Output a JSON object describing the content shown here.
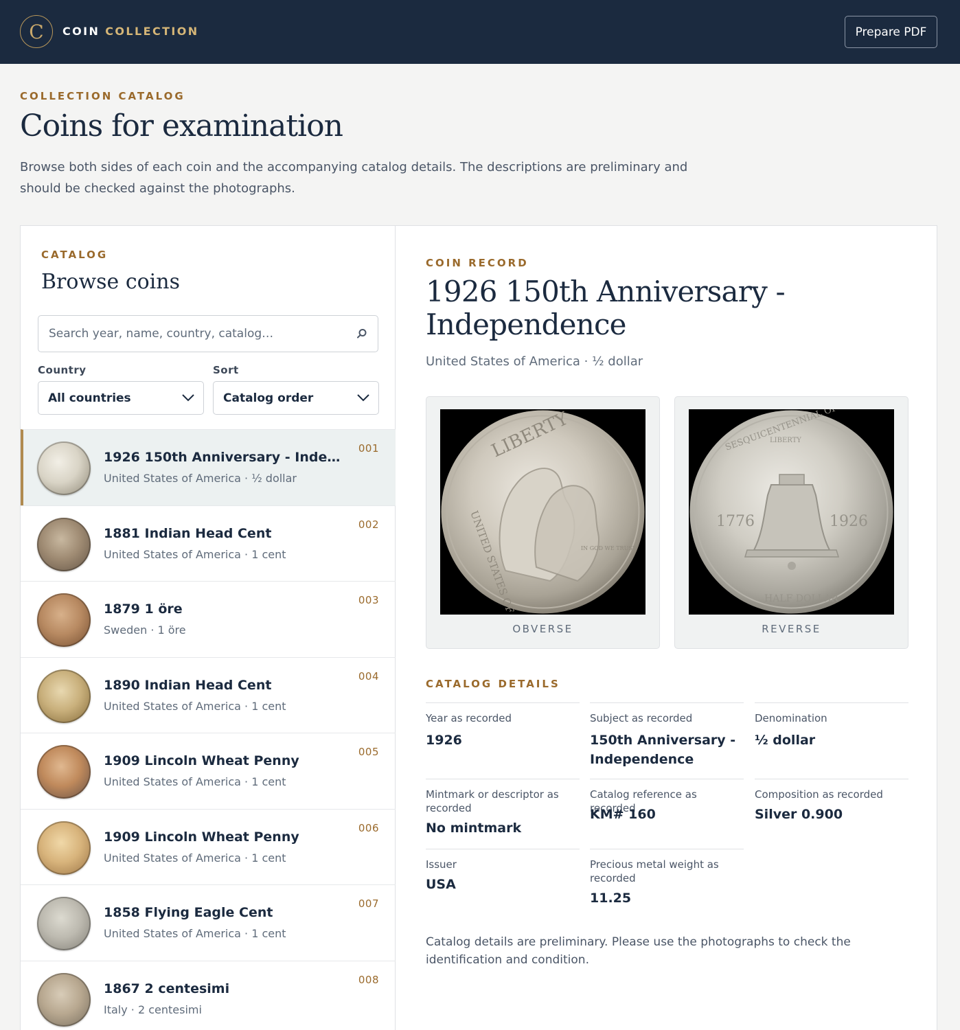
{
  "header": {
    "logo_letter": "C",
    "brand_first": "COIN",
    "brand_second": "COLLECTION",
    "pdf_button": "Prepare PDF"
  },
  "hero": {
    "eyebrow": "COLLECTION CATALOG",
    "title": "Coins for examination",
    "description": "Browse both sides of each coin and the accompanying catalog details. The descriptions are preliminary and should be checked against the photographs."
  },
  "catalog": {
    "eyebrow": "CATALOG",
    "title": "Browse coins",
    "search_placeholder": "Search year, name, country, catalog…",
    "country_label": "Country",
    "country_value": "All countries",
    "sort_label": "Sort",
    "sort_value": "Catalog order",
    "items": [
      {
        "name": "1926 150th Anniversary - Independence",
        "sub": "United States of America · ½ dollar",
        "num": "001",
        "tone": "silver"
      },
      {
        "name": "1881 Indian Head Cent",
        "sub": "United States of America · 1 cent",
        "num": "002",
        "tone": "worn"
      },
      {
        "name": "1879 1 öre",
        "sub": "Sweden · 1 öre",
        "num": "003",
        "tone": "bronze"
      },
      {
        "name": "1890 Indian Head Cent",
        "sub": "United States of America · 1 cent",
        "num": "004",
        "tone": "indian"
      },
      {
        "name": "1909 Lincoln Wheat Penny",
        "sub": "United States of America · 1 cent",
        "num": "005",
        "tone": "copper"
      },
      {
        "name": "1909 Lincoln Wheat Penny",
        "sub": "United States of America · 1 cent",
        "num": "006",
        "tone": "gold"
      },
      {
        "name": "1858 Flying Eagle Cent",
        "sub": "United States of America · 1 cent",
        "num": "007",
        "tone": "grey"
      },
      {
        "name": "1867 2 centesimi",
        "sub": "Italy · 2 centesimi",
        "num": "008",
        "tone": "muted"
      }
    ]
  },
  "record": {
    "eyebrow": "COIN RECORD",
    "title": "1926 150th Anniversary - Independence",
    "subtitle": "United States of America · ½ dollar",
    "obverse_caption": "OBVERSE",
    "reverse_caption": "REVERSE",
    "details_eyebrow": "CATALOG DETAILS",
    "details": [
      {
        "label": "Year as recorded",
        "value": "1926"
      },
      {
        "label": "Subject as recorded",
        "value": "150th Anniversary - Independence"
      },
      {
        "label": "Denomination",
        "value": "½ dollar"
      },
      {
        "label": "Mintmark or descriptor as recorded",
        "value": "No mintmark"
      },
      {
        "label": "Catalog reference as recorded",
        "value": "KM# 160"
      },
      {
        "label": "Composition as recorded",
        "value": "Silver 0.900"
      },
      {
        "label": "Issuer",
        "value": "USA"
      },
      {
        "label": "Precious metal weight as recorded",
        "value": "11.25"
      }
    ],
    "note": "Catalog details are preliminary. Please use the photographs to check the identification and condition."
  },
  "coin_lettering": {
    "obverse": [
      "LIBERTY",
      "UNITED STATES OF AMERICA",
      "IN GOD WE TRUST"
    ],
    "reverse": [
      "SESQUICENTENNIAL OF AMERICAN INDEPENDENCE",
      "LIBERTY",
      "1776",
      "1926",
      "HALF DOLLAR"
    ]
  },
  "colors": {
    "navy": "#1b2a3f",
    "gold_accent": "#9a6a2c",
    "active_row": "#ecf1f1"
  }
}
